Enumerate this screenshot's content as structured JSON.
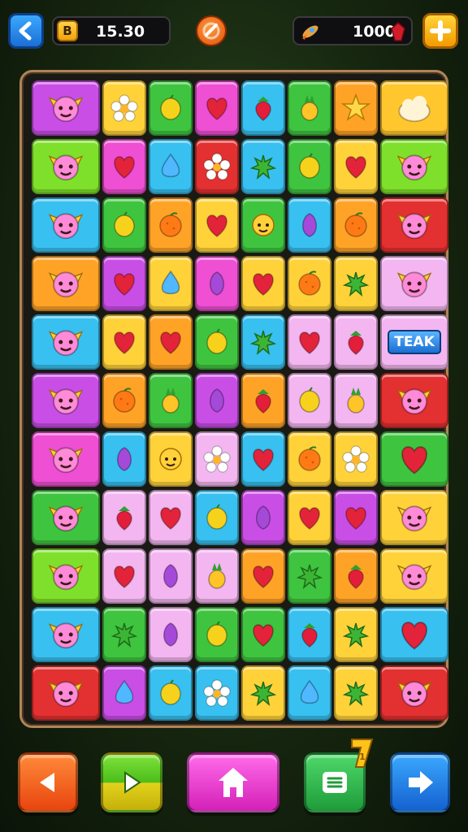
{
  "hud": {
    "coins": "15.30",
    "coin_icon_letter": "B",
    "gems": "1000"
  },
  "board": {
    "rows": 11,
    "cols": 8,
    "label_tile_text": "TEAK",
    "tiles": [
      [
        {
          "c": "#c94ee6",
          "i": "winged"
        },
        {
          "c": "#ffd23a",
          "i": "flower"
        },
        {
          "c": "#3fc43f",
          "i": "lemon"
        },
        {
          "c": "#ee4fd3",
          "i": "heart"
        },
        {
          "c": "#38c0f0",
          "i": "strawberry"
        },
        {
          "c": "#3fc43f",
          "i": "pineapple"
        },
        {
          "c": "#ffa327",
          "i": "star"
        },
        {
          "c": "#ffc62e",
          "i": "cloud"
        }
      ],
      [
        {
          "c": "#7ee02a",
          "i": "winged"
        },
        {
          "c": "#ee4fd3",
          "i": "heart"
        },
        {
          "c": "#38c0f0",
          "i": "drop"
        },
        {
          "c": "#e33030",
          "i": "flower"
        },
        {
          "c": "#38c0f0",
          "i": "cactus"
        },
        {
          "c": "#3fc43f",
          "i": "lemon"
        },
        {
          "c": "#ffd23a",
          "i": "heart"
        },
        {
          "c": "#7ee02a",
          "i": "winged"
        }
      ],
      [
        {
          "c": "#38c0f0",
          "i": "winged"
        },
        {
          "c": "#3fc43f",
          "i": "lemon"
        },
        {
          "c": "#ffa327",
          "i": "orange"
        },
        {
          "c": "#ffd23a",
          "i": "heart"
        },
        {
          "c": "#3fc43f",
          "i": "face"
        },
        {
          "c": "#38c0f0",
          "i": "plum"
        },
        {
          "c": "#ffa327",
          "i": "orange"
        },
        {
          "c": "#e33030",
          "i": "winged"
        }
      ],
      [
        {
          "c": "#ffa327",
          "i": "winged"
        },
        {
          "c": "#c94ee6",
          "i": "heart"
        },
        {
          "c": "#ffd23a",
          "i": "drop"
        },
        {
          "c": "#ee4fd3",
          "i": "plum"
        },
        {
          "c": "#ffd23a",
          "i": "heart"
        },
        {
          "c": "#ffd23a",
          "i": "orange"
        },
        {
          "c": "#ffd23a",
          "i": "cactus"
        },
        {
          "c": "#f3b6f0",
          "i": "winged"
        }
      ],
      [
        {
          "c": "#38c0f0",
          "i": "winged"
        },
        {
          "c": "#ffd23a",
          "i": "heart"
        },
        {
          "c": "#ffa327",
          "i": "heart"
        },
        {
          "c": "#3fc43f",
          "i": "lemon"
        },
        {
          "c": "#38c0f0",
          "i": "cactus"
        },
        {
          "c": "#f3b6f0",
          "i": "heart"
        },
        {
          "c": "#f3b6f0",
          "i": "strawberry"
        },
        {
          "c": "#f3b6f0",
          "i": "label"
        }
      ],
      [
        {
          "c": "#c94ee6",
          "i": "winged"
        },
        {
          "c": "#ffa327",
          "i": "orange"
        },
        {
          "c": "#3fc43f",
          "i": "pineapple"
        },
        {
          "c": "#c94ee6",
          "i": "plum"
        },
        {
          "c": "#ffa327",
          "i": "strawberry"
        },
        {
          "c": "#f3b6f0",
          "i": "lemon"
        },
        {
          "c": "#f3b6f0",
          "i": "pineapple"
        },
        {
          "c": "#e33030",
          "i": "winged"
        }
      ],
      [
        {
          "c": "#ee4fd3",
          "i": "winged"
        },
        {
          "c": "#38c0f0",
          "i": "plum"
        },
        {
          "c": "#ffd23a",
          "i": "face"
        },
        {
          "c": "#f3b6f0",
          "i": "flower"
        },
        {
          "c": "#38c0f0",
          "i": "heart"
        },
        {
          "c": "#ffd23a",
          "i": "orange"
        },
        {
          "c": "#ffd23a",
          "i": "flower"
        },
        {
          "c": "#3fc43f",
          "i": "heart"
        }
      ],
      [
        {
          "c": "#3fc43f",
          "i": "winged"
        },
        {
          "c": "#f3b6f0",
          "i": "strawberry"
        },
        {
          "c": "#f3b6f0",
          "i": "heart"
        },
        {
          "c": "#38c0f0",
          "i": "lemon"
        },
        {
          "c": "#c94ee6",
          "i": "plum"
        },
        {
          "c": "#ffd23a",
          "i": "heart"
        },
        {
          "c": "#c94ee6",
          "i": "heart"
        },
        {
          "c": "#ffd23a",
          "i": "winged"
        }
      ],
      [
        {
          "c": "#7ee02a",
          "i": "winged"
        },
        {
          "c": "#f3b6f0",
          "i": "heart"
        },
        {
          "c": "#f3b6f0",
          "i": "plum"
        },
        {
          "c": "#f3b6f0",
          "i": "pineapple"
        },
        {
          "c": "#ffa327",
          "i": "heart"
        },
        {
          "c": "#3fc43f",
          "i": "cactus"
        },
        {
          "c": "#ffa327",
          "i": "strawberry"
        },
        {
          "c": "#ffd23a",
          "i": "winged"
        }
      ],
      [
        {
          "c": "#38c0f0",
          "i": "winged"
        },
        {
          "c": "#3fc43f",
          "i": "cactus"
        },
        {
          "c": "#f3b6f0",
          "i": "plum"
        },
        {
          "c": "#3fc43f",
          "i": "lemon"
        },
        {
          "c": "#3fc43f",
          "i": "heart"
        },
        {
          "c": "#38c0f0",
          "i": "strawberry"
        },
        {
          "c": "#ffd23a",
          "i": "cactus"
        },
        {
          "c": "#38c0f0",
          "i": "heart"
        }
      ],
      [
        {
          "c": "#e33030",
          "i": "winged"
        },
        {
          "c": "#c94ee6",
          "i": "drop"
        },
        {
          "c": "#38c0f0",
          "i": "lemon"
        },
        {
          "c": "#38c0f0",
          "i": "flower"
        },
        {
          "c": "#ffd23a",
          "i": "cactus"
        },
        {
          "c": "#38c0f0",
          "i": "drop"
        },
        {
          "c": "#ffd23a",
          "i": "cactus"
        },
        {
          "c": "#e33030",
          "i": "winged"
        }
      ]
    ]
  },
  "bottom": {
    "badge_text": "1"
  },
  "colors": {
    "icon_fill": {
      "heart": "#e3233a",
      "lemon": "#f6d21c",
      "orange": "#ff7a14",
      "plum": "#a449d8",
      "drop": "#4fb8ff",
      "strawberry": "#e31e3a",
      "pineapple": "#ffc428",
      "star": "#ffd84a",
      "cloud": "#fff4d6",
      "flower": "#ffffff",
      "cactus": "#3db534",
      "face": "#ffd23a",
      "winged": "#ff8ad8"
    }
  }
}
